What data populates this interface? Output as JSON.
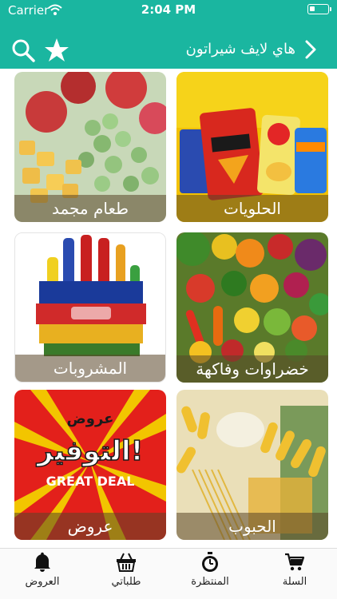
{
  "status_bar": {
    "carrier": "Carrier",
    "time": "2:04 PM"
  },
  "header": {
    "title": "هاي لايف شيراتون"
  },
  "categories": [
    {
      "label": "الحلويات"
    },
    {
      "label": "طعام مجمد"
    },
    {
      "label": "خضراوات وفاكهة"
    },
    {
      "label": "المشروبات"
    },
    {
      "label": "الحبوب"
    },
    {
      "label": "عروض"
    }
  ],
  "promo_art": {
    "line1": "عروض",
    "line2": "التوفير!",
    "line3": "GREAT DEAL"
  },
  "tabs": [
    {
      "label": "السلة",
      "icon": "cart-icon"
    },
    {
      "label": "المنتظرة",
      "icon": "stopwatch-icon"
    },
    {
      "label": "طلباتي",
      "icon": "basket-icon"
    },
    {
      "label": "العروض",
      "icon": "bell-icon"
    }
  ],
  "colors": {
    "brand": "#1ab6a0",
    "label_overlay": "rgba(90,70,40,0.55)"
  }
}
